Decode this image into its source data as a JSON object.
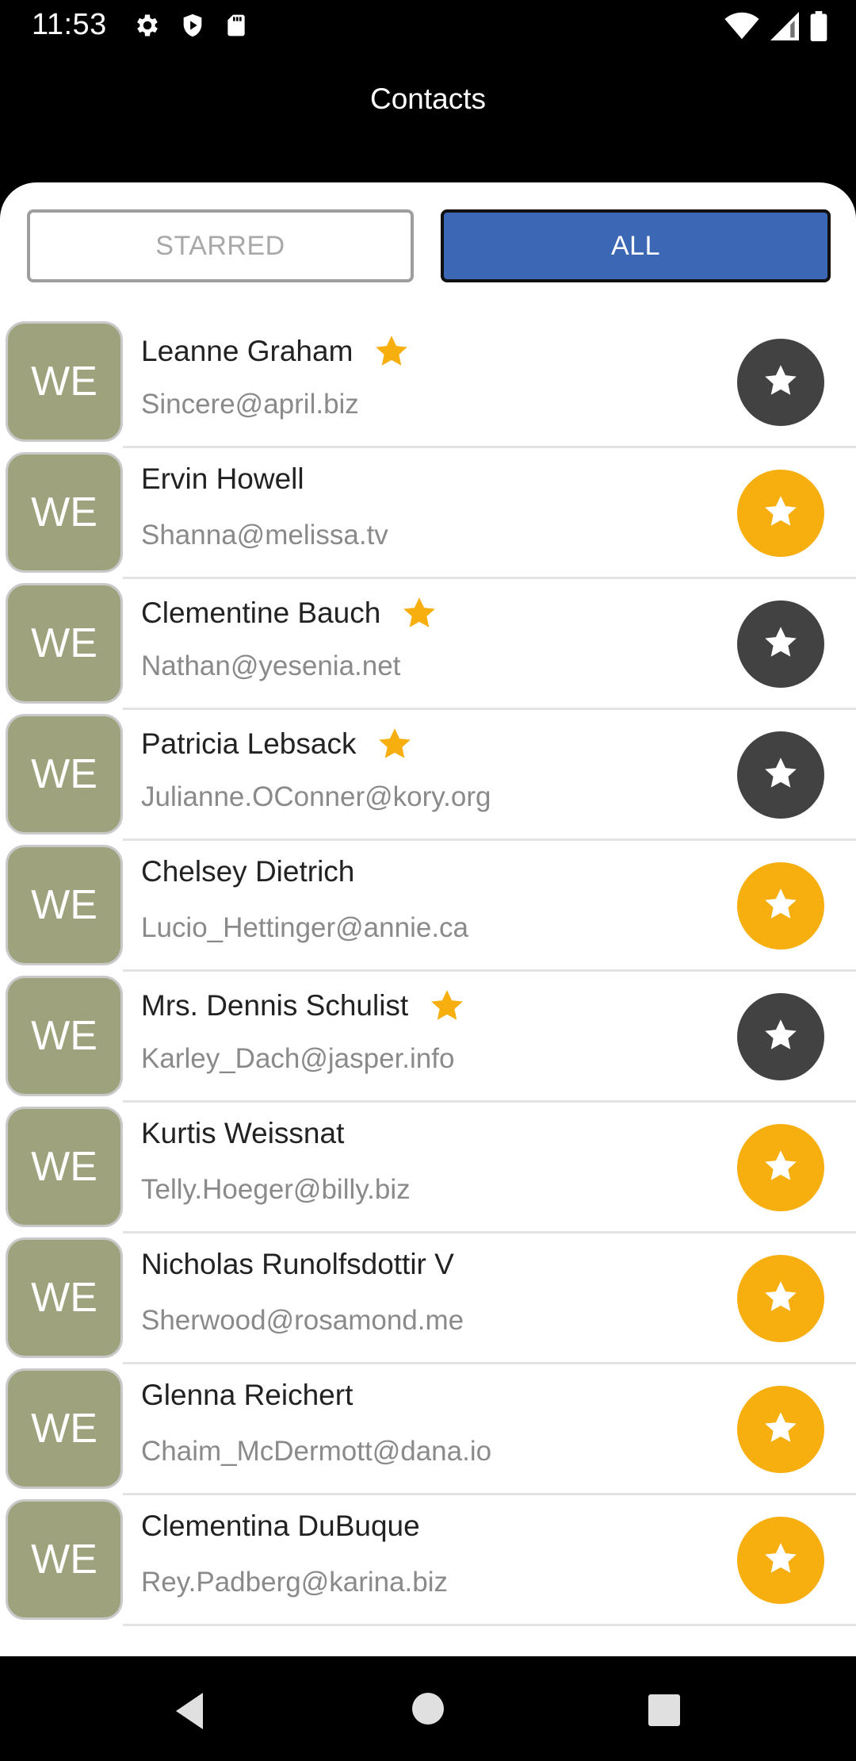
{
  "status_bar": {
    "time": "11:53",
    "left_icons": [
      "gear-icon",
      "shield-icon",
      "sd-card-icon"
    ],
    "right_icons": [
      "wifi-icon",
      "signal-icon",
      "battery-icon"
    ]
  },
  "header": {
    "title": "Contacts"
  },
  "tabs": {
    "starred_label": "STARRED",
    "all_label": "ALL",
    "selected": "ALL"
  },
  "contacts": [
    {
      "initials": "WE",
      "name": "Leanne Graham",
      "email": "Sincere@april.biz",
      "starred": true
    },
    {
      "initials": "WE",
      "name": "Ervin Howell",
      "email": "Shanna@melissa.tv",
      "starred": false
    },
    {
      "initials": "WE",
      "name": "Clementine Bauch",
      "email": "Nathan@yesenia.net",
      "starred": true
    },
    {
      "initials": "WE",
      "name": "Patricia Lebsack",
      "email": "Julianne.OConner@kory.org",
      "starred": true
    },
    {
      "initials": "WE",
      "name": "Chelsey Dietrich",
      "email": "Lucio_Hettinger@annie.ca",
      "starred": false
    },
    {
      "initials": "WE",
      "name": "Mrs. Dennis Schulist",
      "email": "Karley_Dach@jasper.info",
      "starred": true
    },
    {
      "initials": "WE",
      "name": "Kurtis Weissnat",
      "email": "Telly.Hoeger@billy.biz",
      "starred": false
    },
    {
      "initials": "WE",
      "name": "Nicholas Runolfsdottir V",
      "email": "Sherwood@rosamond.me",
      "starred": false
    },
    {
      "initials": "WE",
      "name": "Glenna Reichert",
      "email": "Chaim_McDermott@dana.io",
      "starred": false
    },
    {
      "initials": "WE",
      "name": "Clementina DuBuque",
      "email": "Rey.Padberg@karina.biz",
      "starred": false
    }
  ],
  "colors": {
    "accent_blue": "#3b67b5",
    "star_gold": "#f7ae0f",
    "fab_dark": "#424242",
    "avatar_bg": "#9ea37d"
  },
  "nav": {
    "icons": [
      "back-icon",
      "home-icon",
      "recents-icon"
    ]
  }
}
